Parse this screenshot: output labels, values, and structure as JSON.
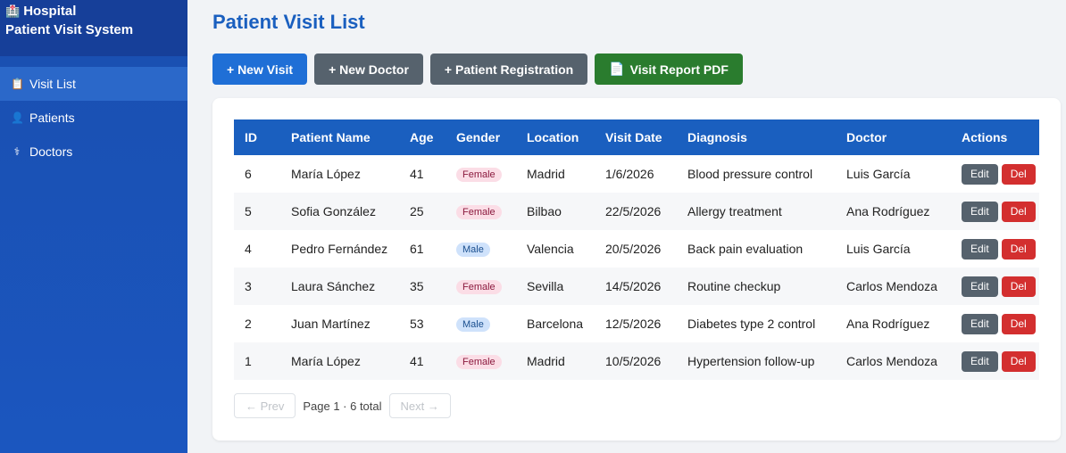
{
  "sidebar": {
    "brand_line1": "Hospital",
    "brand_line2": "Patient Visit System",
    "brand_icon": "hospital-icon",
    "items": [
      {
        "label": "Visit List",
        "icon": "clipboard-icon",
        "active": true
      },
      {
        "label": "Patients",
        "icon": "person-icon",
        "active": false
      },
      {
        "label": "Doctors",
        "icon": "doctor-icon",
        "active": false
      }
    ]
  },
  "main": {
    "title": "Patient Visit List",
    "buttons": {
      "new_visit": "+ New Visit",
      "new_doctor": "+ New Doctor",
      "patient_registration": "+ Patient Registration",
      "visit_report": "Visit Report PDF"
    }
  },
  "table": {
    "headers": [
      "ID",
      "Patient Name",
      "Age",
      "Gender",
      "Location",
      "Visit Date",
      "Diagnosis",
      "Doctor",
      "Actions"
    ],
    "rows": [
      {
        "id": "6",
        "name": "María López",
        "age": "41",
        "gender": "Female",
        "location": "Madrid",
        "date": "1/6/2026",
        "diagnosis": "Blood pressure control",
        "doctor": "Luis García"
      },
      {
        "id": "5",
        "name": "Sofia González",
        "age": "25",
        "gender": "Female",
        "location": "Bilbao",
        "date": "22/5/2026",
        "diagnosis": "Allergy treatment",
        "doctor": "Ana Rodríguez"
      },
      {
        "id": "4",
        "name": "Pedro Fernández",
        "age": "61",
        "gender": "Male",
        "location": "Valencia",
        "date": "20/5/2026",
        "diagnosis": "Back pain evaluation",
        "doctor": "Luis García"
      },
      {
        "id": "3",
        "name": "Laura Sánchez",
        "age": "35",
        "gender": "Female",
        "location": "Sevilla",
        "date": "14/5/2026",
        "diagnosis": "Routine checkup",
        "doctor": "Carlos Mendoza"
      },
      {
        "id": "2",
        "name": "Juan Martínez",
        "age": "53",
        "gender": "Male",
        "location": "Barcelona",
        "date": "12/5/2026",
        "diagnosis": "Diabetes type 2 control",
        "doctor": "Ana Rodríguez"
      },
      {
        "id": "1",
        "name": "María López",
        "age": "41",
        "gender": "Female",
        "location": "Madrid",
        "date": "10/5/2026",
        "diagnosis": "Hypertension follow-up",
        "doctor": "Carlos Mendoza"
      }
    ],
    "edit_label": "Edit",
    "delete_label": "Del"
  },
  "pagination": {
    "prev_label": "← Prev",
    "info": "Page 1 · 6 total",
    "next_label": "Next →"
  },
  "colors": {
    "primary": "#1a5fbf",
    "sidebar": "#1a4fb0",
    "danger": "#d32f2f",
    "success": "#2a7c2e"
  }
}
